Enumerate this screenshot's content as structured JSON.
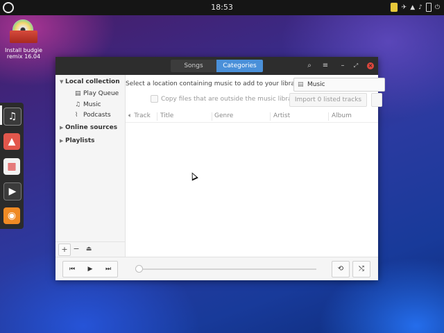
{
  "panel": {
    "clock": "18:53"
  },
  "desktop": {
    "icon_label": "Install budgie remix 16.04"
  },
  "window": {
    "tabs": [
      {
        "label": "Songs",
        "active": false
      },
      {
        "label": "Categories",
        "active": true
      }
    ],
    "header_buttons": [
      "search-icon",
      "menu-icon",
      "minimize-icon",
      "restore-icon",
      "close-icon"
    ]
  },
  "sidebar": {
    "local_collection": "Local collection",
    "items": [
      {
        "label": "Play Queue",
        "icon": "play-queue-icon"
      },
      {
        "label": "Music",
        "icon": "music-note-icon"
      },
      {
        "label": "Podcasts",
        "icon": "podcast-icon"
      }
    ],
    "online_sources": "Online sources",
    "playlists": "Playlists",
    "bottom_buttons": [
      "+",
      "−",
      "⏏"
    ]
  },
  "main": {
    "location_prompt": "Select a location containing music to add to your library:",
    "folder": "Music",
    "copy_files": "Copy files that are outside the music library",
    "import_button": "Import 0 listed tracks",
    "columns": [
      "Track",
      "Title",
      "Genre",
      "Artist",
      "Album"
    ]
  },
  "controls": {
    "previous": "⏮",
    "play": "▶",
    "next": "⏭",
    "repeat": "⟲",
    "shuffle": "⤭"
  },
  "colors": {
    "accent": "#4a90d9",
    "close": "#e0463c",
    "headerbar": "#2d2d2d"
  }
}
